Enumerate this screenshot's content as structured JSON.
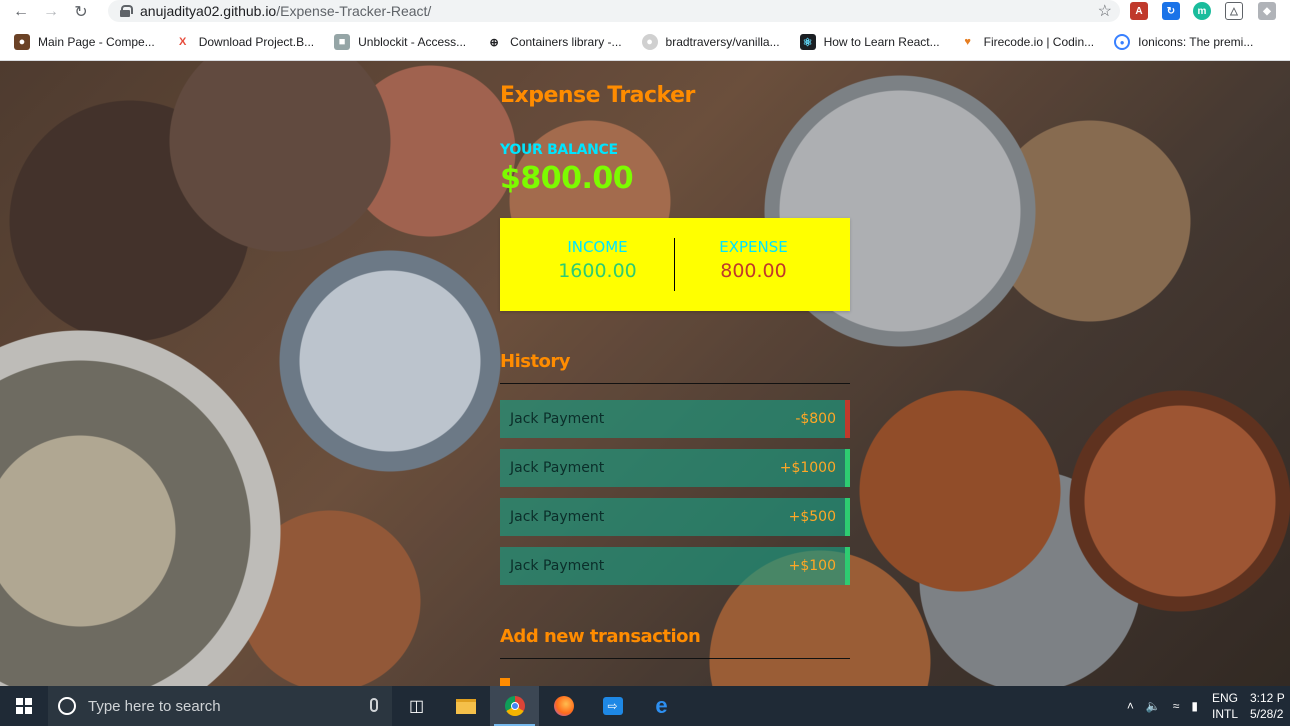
{
  "browser": {
    "url_host": "anujaditya02.github.io",
    "url_path": "/Expense-Tracker-React/",
    "bookmarks": [
      "Main Page - Compe...",
      "Download Project.B...",
      "Unblockit - Access...",
      "Containers library -...",
      "bradtraversy/vanilla...",
      "How to Learn React...",
      "Firecode.io | Codin...",
      "Ionicons: The premi..."
    ]
  },
  "app": {
    "title": "Expense Tracker",
    "balance_label": "YOUR BALANCE",
    "balance_value": "$800.00",
    "income_label": "INCOME",
    "income_value": "1600.00",
    "expense_label": "EXPENSE",
    "expense_value": "800.00",
    "history_heading": "History",
    "transactions": [
      {
        "text": "Jack Payment",
        "amount": "-$800"
      },
      {
        "text": "Jack Payment",
        "amount": "+$1000"
      },
      {
        "text": "Jack Payment",
        "amount": "+$500"
      },
      {
        "text": "Jack Payment",
        "amount": "+$100"
      }
    ],
    "add_heading": "Add new transaction"
  },
  "taskbar": {
    "search_placeholder": "Type here to search",
    "lang_top": "ENG",
    "lang_bottom": "INTL",
    "time": "3:12 P",
    "date": "5/28/2"
  },
  "colors": {
    "title": "#ff8c00",
    "balance_label": "#00e5ff",
    "balance_value": "#7cfc00",
    "inc_exp_bg": "#ffff00",
    "income_value": "#2ecc71",
    "expense_value": "#c0392b",
    "item_bg": "#16a085"
  }
}
